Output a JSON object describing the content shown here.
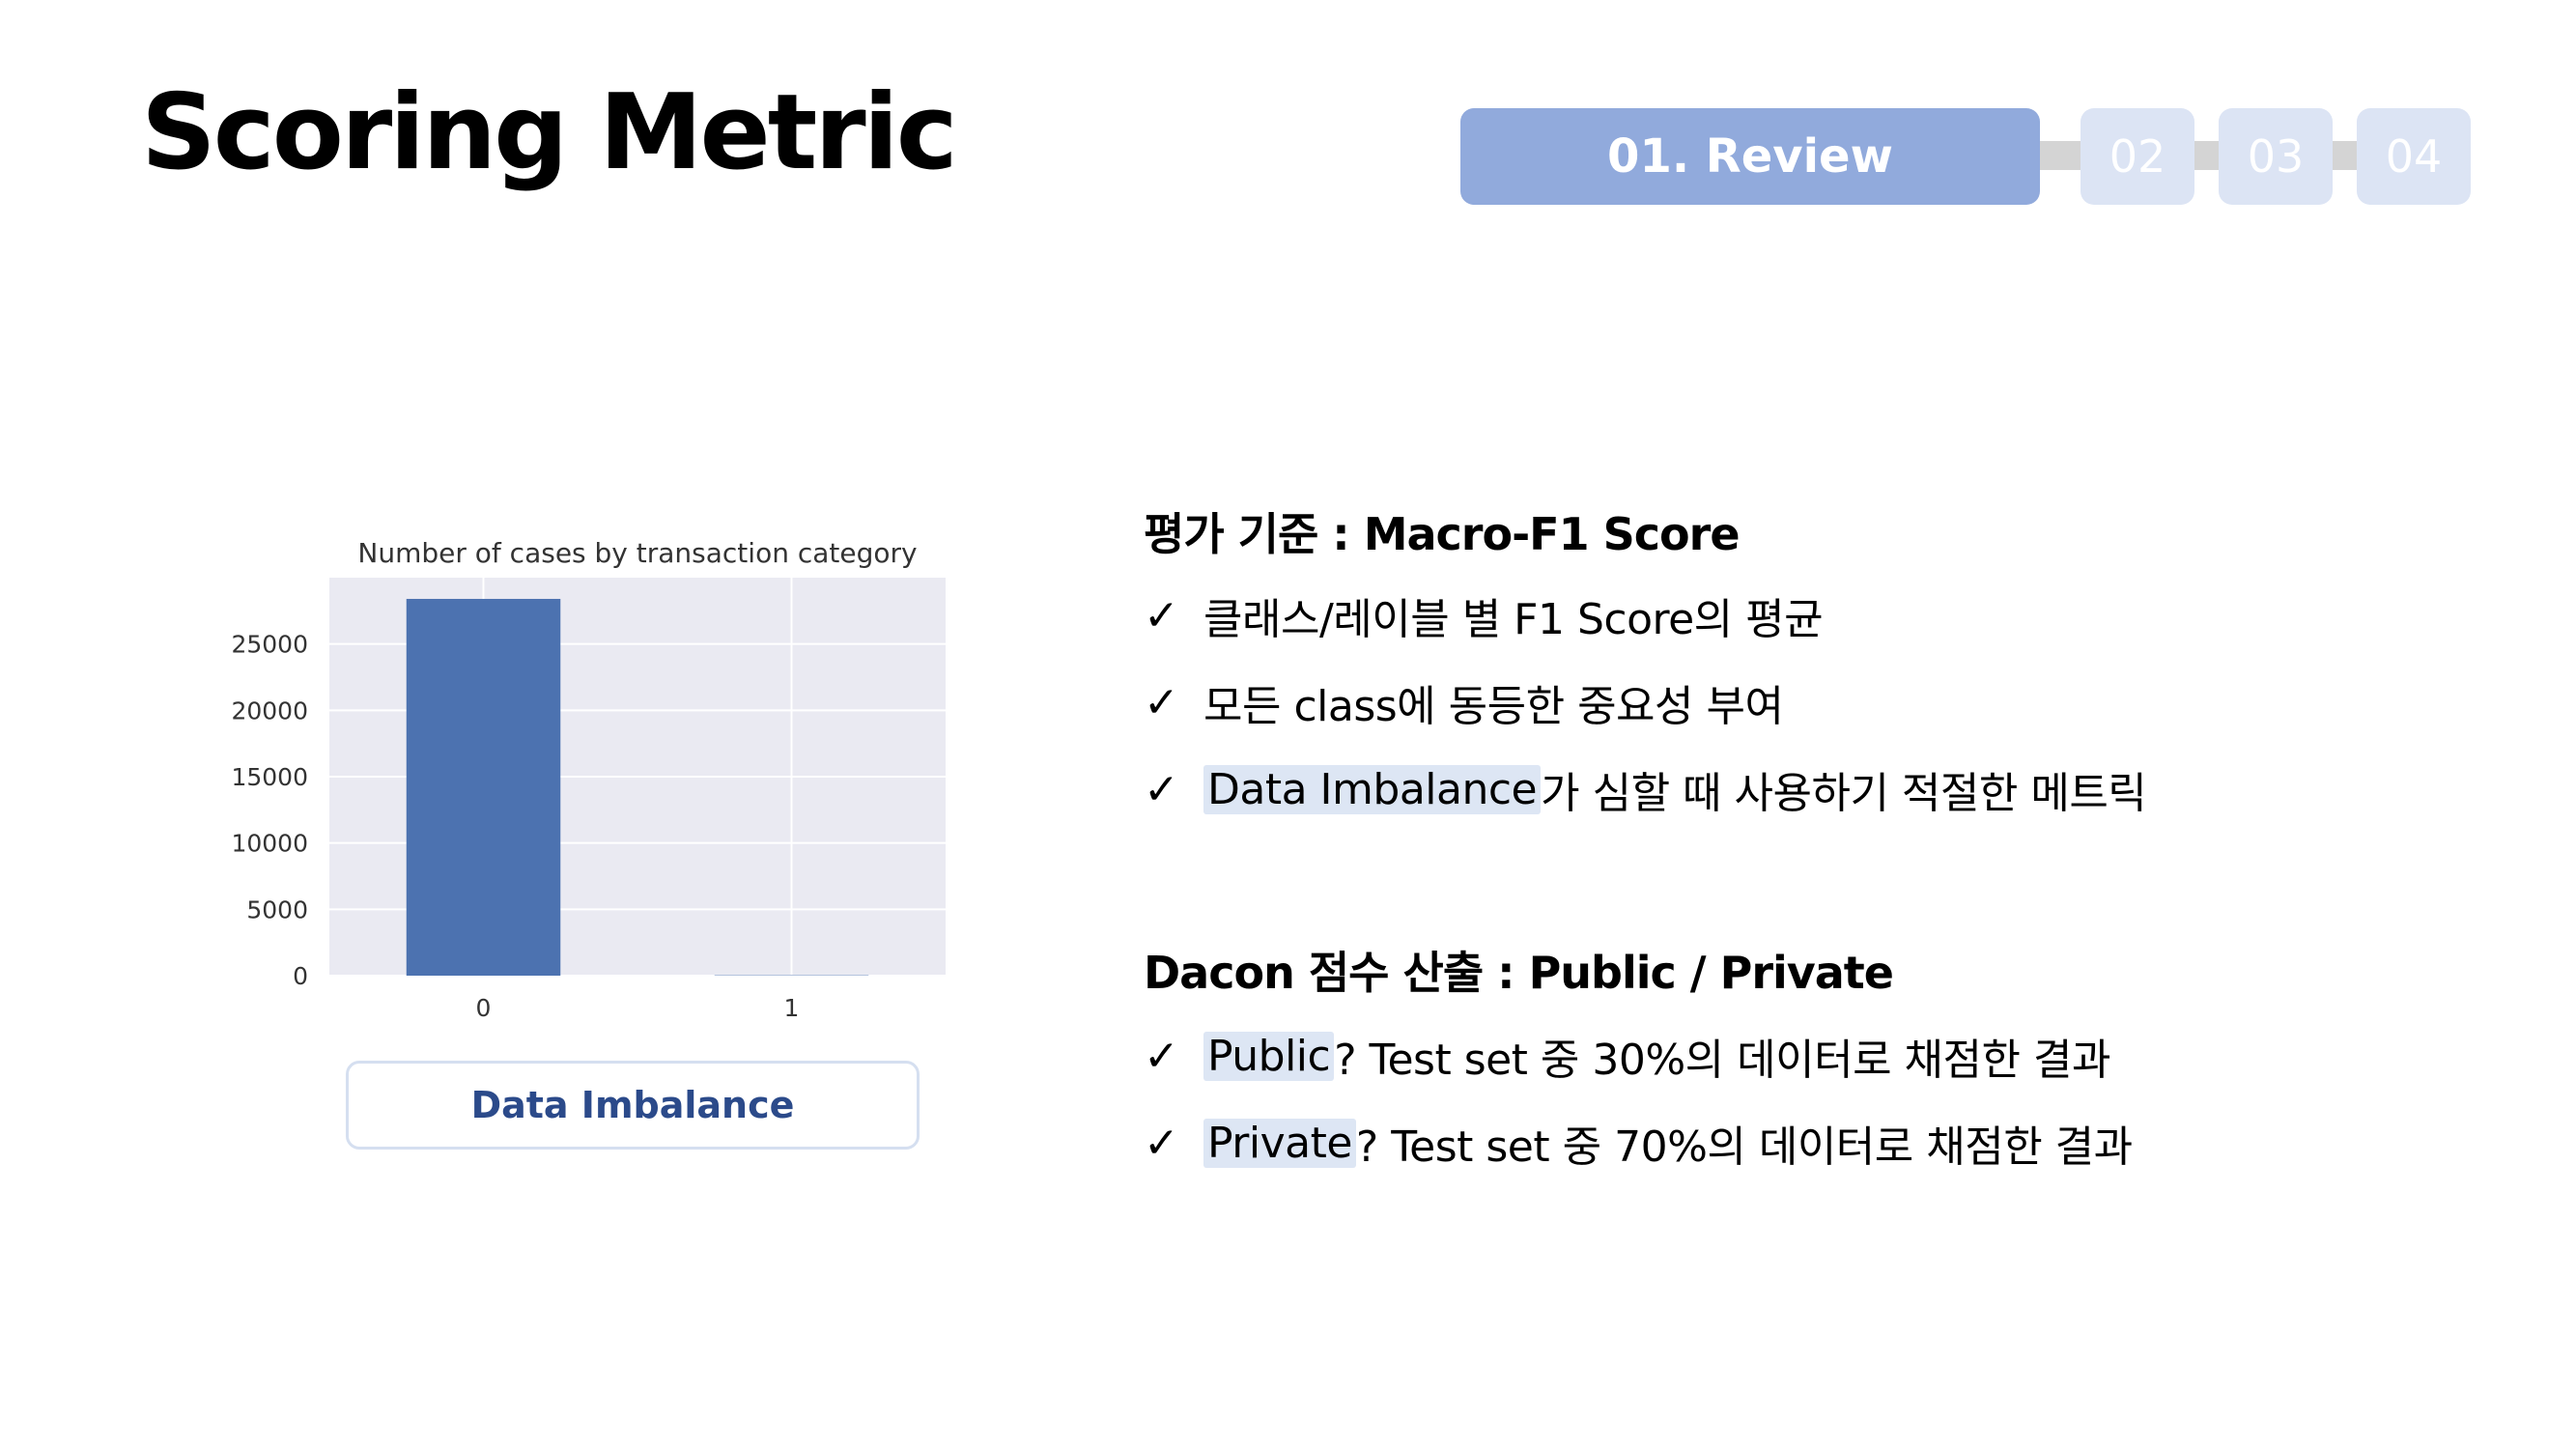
{
  "slide": {
    "title": "Scoring Metric"
  },
  "nav": {
    "steps": [
      {
        "label": "01. Review",
        "active": true
      },
      {
        "label": "02",
        "active": false
      },
      {
        "label": "03",
        "active": false
      },
      {
        "label": "04",
        "active": false
      }
    ],
    "colors": {
      "active": "#91aadc",
      "inactive": "#dce4f4",
      "connector": "#d4d4d4"
    }
  },
  "chart_data": {
    "type": "bar",
    "title": "Number of cases by transaction category",
    "categories": [
      "0",
      "1"
    ],
    "values": [
      28400,
      30
    ],
    "xlabel": "",
    "ylabel": "",
    "ylim": [
      0,
      30000
    ],
    "yticks": [
      0,
      5000,
      10000,
      15000,
      20000,
      25000
    ],
    "grid": true,
    "bar_color": "#4c72b0",
    "background_color": "#eaeaf2"
  },
  "chart_caption": "Data Imbalance",
  "criteria": {
    "heading": "평가 기준 : Macro-F1 Score",
    "items": [
      {
        "check": "✓",
        "highlight": "",
        "text": "클래스/레이블 별 F1 Score의 평균"
      },
      {
        "check": "✓",
        "highlight": "",
        "text": "모든 class에 동등한 중요성 부여"
      },
      {
        "check": "✓",
        "highlight": "Data Imbalance",
        "text": " 가 심할 때 사용하기 적절한 메트릭"
      }
    ]
  },
  "scoring": {
    "heading": "Dacon 점수 산출 : Public / Private",
    "items": [
      {
        "check": "✓",
        "highlight": "Public",
        "text": "? Test set 중 30%의 데이터로 채점한 결과"
      },
      {
        "check": "✓",
        "highlight": "Private",
        "text": "? Test set 중 70%의 데이터로 채점한 결과"
      }
    ]
  }
}
